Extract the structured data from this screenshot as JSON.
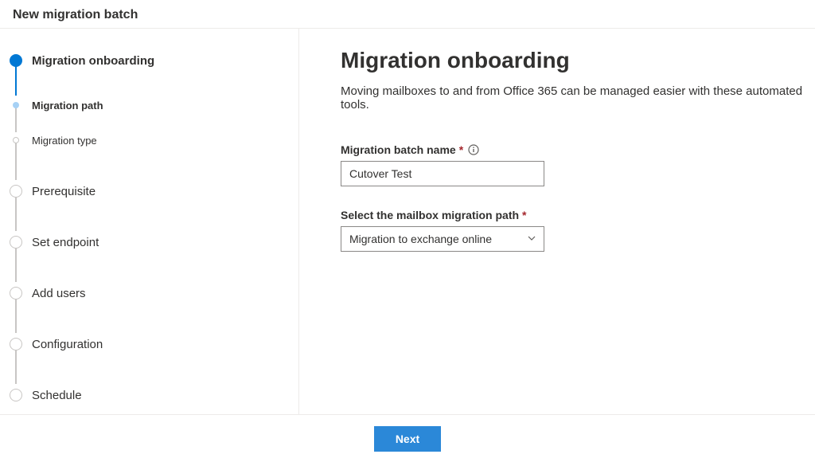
{
  "header": {
    "title": "New migration batch"
  },
  "sidebar": {
    "steps": [
      {
        "label": "Migration onboarding",
        "state": "completed"
      },
      {
        "label": "Migration path",
        "state": "current"
      },
      {
        "label": "Migration type",
        "state": "upcoming-small"
      },
      {
        "label": "Prerequisite",
        "state": "upcoming"
      },
      {
        "label": "Set endpoint",
        "state": "upcoming"
      },
      {
        "label": "Add users",
        "state": "upcoming"
      },
      {
        "label": "Configuration",
        "state": "upcoming"
      },
      {
        "label": "Schedule",
        "state": "upcoming"
      }
    ]
  },
  "main": {
    "title": "Migration onboarding",
    "description": "Moving mailboxes to and from Office 365 can be managed easier with these automated tools.",
    "fields": {
      "batch_name_label": "Migration batch name",
      "batch_name_value": "Cutover Test",
      "migration_path_label": "Select the mailbox migration path",
      "migration_path_value": "Migration to exchange online"
    }
  },
  "footer": {
    "next_label": "Next"
  }
}
